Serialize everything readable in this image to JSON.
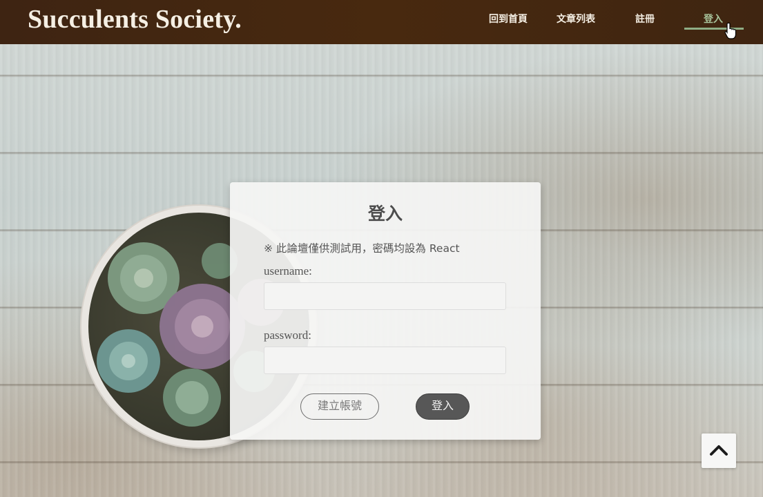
{
  "header": {
    "brand": "Succulents Society.",
    "nav": [
      {
        "label": "回到首頁",
        "active": false
      },
      {
        "label": "文章列表",
        "active": false
      },
      {
        "label": "註冊",
        "active": false
      },
      {
        "label": "登入",
        "active": true
      }
    ]
  },
  "login": {
    "title": "登入",
    "notice": "※ 此論壇僅供測試用，密碼均設為 React",
    "username_label": "username:",
    "username_value": "",
    "password_label": "password:",
    "password_value": "",
    "register_button": "建立帳號",
    "login_button": "登入"
  },
  "icons": {
    "scroll_top": "chevron-up-icon",
    "cursor": "hand-pointer-icon"
  },
  "colors": {
    "header_bg": "#45280f",
    "brand_text": "#f5efe4",
    "nav_active": "#a7c39b",
    "button_solid": "#575757"
  }
}
